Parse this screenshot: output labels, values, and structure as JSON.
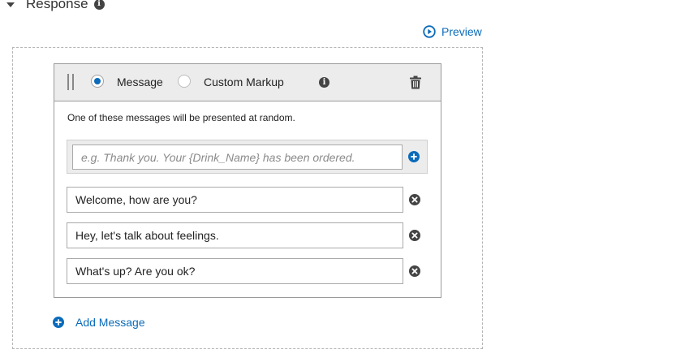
{
  "section": {
    "title": "Response"
  },
  "preview": {
    "label": "Preview"
  },
  "card": {
    "options": [
      {
        "label": "Message",
        "selected": true
      },
      {
        "label": "Custom Markup",
        "selected": false
      }
    ],
    "note": "One of these messages will be presented at random.",
    "new_message_placeholder": "e.g. Thank you. Your {Drink_Name} has been ordered.",
    "messages": [
      "Welcome, how are you?",
      "Hey, let's talk about feelings.",
      "What's up? Are you ok?"
    ]
  },
  "add_message": {
    "label": "Add Message"
  },
  "icons": {
    "section_caret": "caret-down-icon",
    "section_info": "info-icon",
    "preview": "play-circle-icon",
    "drag": "drag-handle-icon",
    "toolbar_info": "info-icon",
    "delete": "trash-icon",
    "add": "plus-circle-icon",
    "remove": "close-circle-icon"
  },
  "colors": {
    "link": "#0b6bba",
    "icon_dark": "#444444",
    "toolbar_bg": "#ececec"
  }
}
